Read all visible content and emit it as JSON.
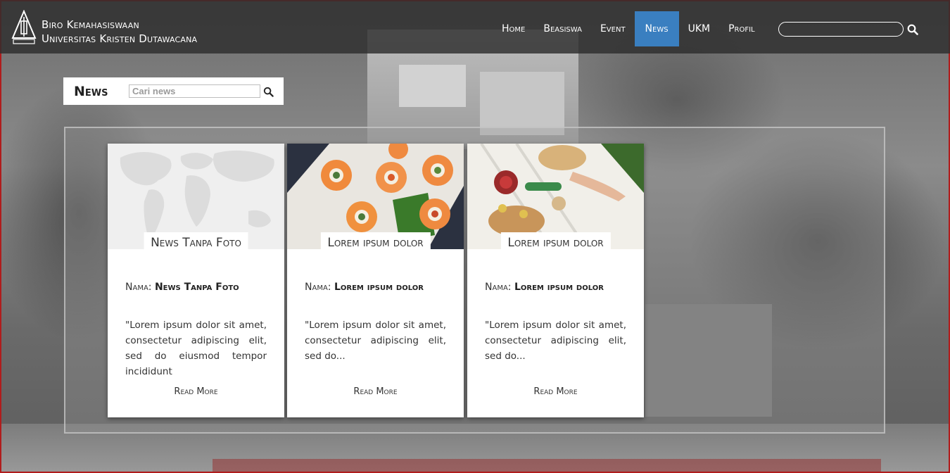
{
  "brand": {
    "line1": "Biro Kemahasiswaan",
    "line2": "Universitas Kristen Dutawacana"
  },
  "nav": {
    "items": [
      "Home",
      "Beasiswa",
      "Event",
      "News",
      "UKM",
      "Profil"
    ],
    "active": "News",
    "search_placeholder": ""
  },
  "news": {
    "title": "News",
    "search_placeholder": "Cari news"
  },
  "cards": [
    {
      "caption": "News Tanpa Foto",
      "name_label": "Nama:",
      "name_value": "News Tanpa Foto",
      "excerpt": "\"Lorem ipsum dolor sit amet, consectetur adipiscing elit, sed do eiusmod tempor incididunt",
      "more": "Read More",
      "image": "world-map"
    },
    {
      "caption": "Lorem ipsum dolor",
      "name_label": "Nama:",
      "name_value": "Lorem ipsum dolor",
      "excerpt": "\"Lorem ipsum dolor sit amet, consectetur adipiscing elit, sed do...",
      "more": "Read More",
      "image": "sushi-photo"
    },
    {
      "caption": "Lorem ipsum dolor",
      "name_label": "Nama:",
      "name_value": "Lorem ipsum dolor",
      "excerpt": "\"Lorem ipsum dolor sit amet, consectetur adipiscing elit, sed do...",
      "more": "Read More",
      "image": "picnic-photo"
    }
  ],
  "colors": {
    "accent": "#3a7fc0",
    "navbar": "#2d2d2d",
    "frame": "#b01c1c"
  }
}
